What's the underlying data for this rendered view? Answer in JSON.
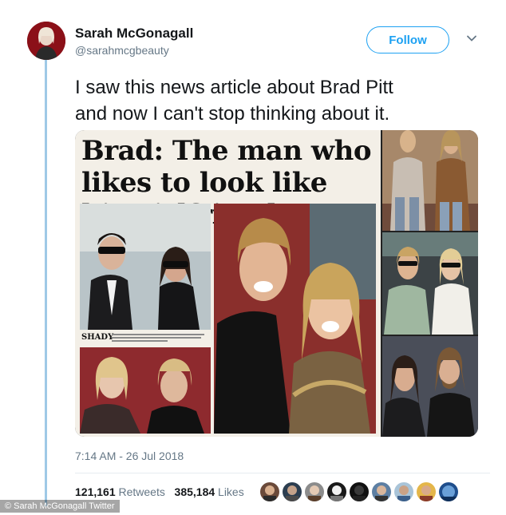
{
  "user": {
    "name": "Sarah McGonagall",
    "handle": "@sarahmcgbeauty"
  },
  "follow_label": "Follow",
  "tweet": {
    "text": "I saw this news article about Brad Pitt\nand now I can't stop thinking about it."
  },
  "media": {
    "newspaper_headline": "Brad: The man who likes to look like his girlfriend",
    "caption_label": "SHADY"
  },
  "meta": {
    "timestamp": "7:14 AM - 26 Jul 2018"
  },
  "stats": {
    "retweets_count": "121,161",
    "retweets_label": "Retweets",
    "likes_count": "385,184",
    "likes_label": "Likes"
  },
  "liker_avatars": 9,
  "credit": "© Sarah McGonagall Twitter",
  "colors": {
    "accent": "#1da1f2",
    "secondary_text": "#657786",
    "thread_line": "#9fc9e6"
  }
}
